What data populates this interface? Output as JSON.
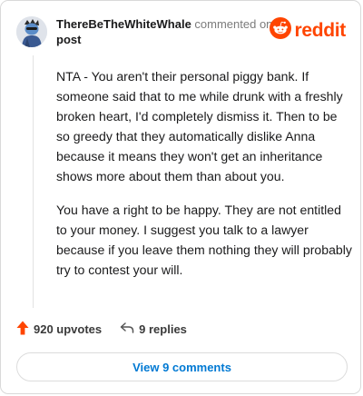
{
  "header": {
    "username": "ThereBeTheWhiteWhale",
    "action_text": "commented on",
    "target_link": "post",
    "brand": "reddit"
  },
  "comment": {
    "paragraphs": [
      "NTA - You aren't their personal piggy bank. If someone said that to me while drunk with a freshly broken heart, I'd completely dismiss it. Then to be so greedy that they automatically dislike Anna because it means they won't get an inheritance shows more about them than about you.",
      "You have a right to be happy. They are not entitled to your money. I suggest you talk to a lawyer because if you leave them nothing they will probably try to contest your will."
    ]
  },
  "actions": {
    "upvotes": "920 upvotes",
    "replies": "9 replies"
  },
  "footer": {
    "view_comments": "View 9 comments"
  },
  "colors": {
    "brand": "#ff4500",
    "link": "#0079d3"
  },
  "icons": [
    "avatar",
    "reddit-logo-icon",
    "upvote-arrow-icon",
    "reply-icon"
  ]
}
